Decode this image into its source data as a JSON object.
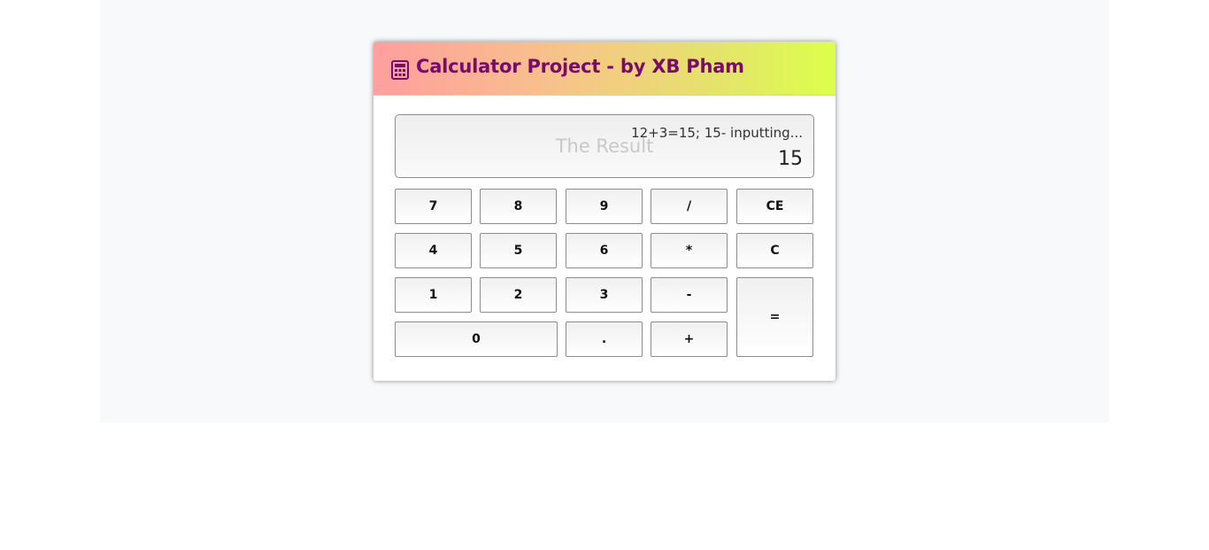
{
  "header": {
    "title": "Calculator Project - by XB Pham",
    "icon": "calculator-icon",
    "title_color": "#7a0a6e"
  },
  "display": {
    "placeholder": "The Result",
    "history": "12+3=15; 15- inputting...",
    "result": "15"
  },
  "keys": {
    "seven": "7",
    "eight": "8",
    "nine": "9",
    "divide": "/",
    "clear_entry": "CE",
    "four": "4",
    "five": "5",
    "six": "6",
    "multiply": "*",
    "clear": "C",
    "one": "1",
    "two": "2",
    "three": "3",
    "subtract": "-",
    "equals": "=",
    "zero": "0",
    "decimal": ".",
    "add": "+"
  }
}
